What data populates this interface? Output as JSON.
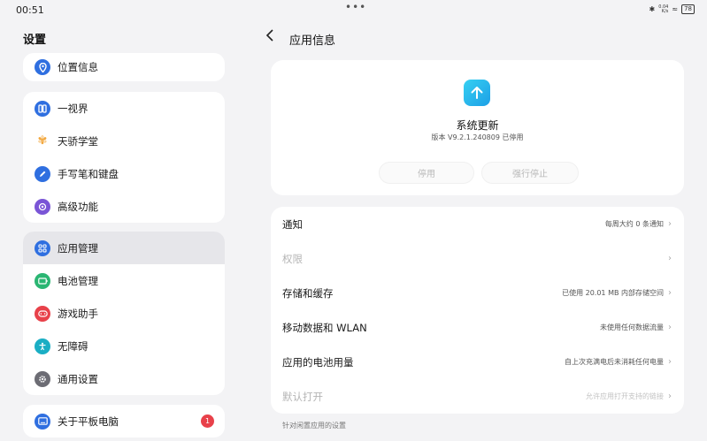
{
  "status_bar": {
    "time": "00:51",
    "dots": "•••",
    "network": "0.04\nK/s",
    "battery": "78"
  },
  "left": {
    "title": "设置",
    "groups": [
      {
        "items": [
          {
            "label": "位置信息",
            "icon": "location-icon",
            "color": "#2f6fe0"
          }
        ]
      },
      {
        "items": [
          {
            "label": "一视界",
            "icon": "split-screen-icon",
            "color": "#2f6fe0"
          },
          {
            "label": "天骄学堂",
            "icon": "butterfly-icon",
            "color": "#f2a63b"
          },
          {
            "label": "手写笔和键盘",
            "icon": "pen-icon",
            "color": "#2f6fe0"
          },
          {
            "label": "高级功能",
            "icon": "advanced-icon",
            "color": "#7a55d6"
          }
        ]
      },
      {
        "items": [
          {
            "label": "应用管理",
            "icon": "apps-icon",
            "color": "#2f6fe0"
          },
          {
            "label": "电池管理",
            "icon": "battery-icon",
            "color": "#2bb673"
          },
          {
            "label": "游戏助手",
            "icon": "gamepad-icon",
            "color": "#e8414a"
          },
          {
            "label": "无障碍",
            "icon": "accessibility-icon",
            "color": "#1aaec4"
          },
          {
            "label": "通用设置",
            "icon": "gear-icon",
            "color": "#6c6c74"
          }
        ]
      },
      {
        "items": [
          {
            "label": "关于平板电脑",
            "icon": "tablet-icon",
            "color": "#2f6fe0",
            "badge": "1"
          }
        ]
      }
    ]
  },
  "right": {
    "title": "应用信息",
    "app": {
      "name": "系统更新",
      "version": "版本 V9.2.1.240809 已停用",
      "disable_label": "停用",
      "force_stop_label": "强行停止"
    },
    "settings": [
      {
        "label": "通知",
        "value": "每周大约 0 条通知",
        "disabled": false
      },
      {
        "label": "权限",
        "value": "",
        "disabled": true
      },
      {
        "label": "存储和缓存",
        "value": "已使用 20.01 MB 内部存储空间",
        "disabled": false
      },
      {
        "label": "移动数据和 WLAN",
        "value": "未使用任何数据流量",
        "disabled": false
      },
      {
        "label": "应用的电池用量",
        "value": "自上次充满电后未消耗任何电量",
        "disabled": false
      },
      {
        "label": "默认打开",
        "value": "允许应用打开支持的链接",
        "disabled": true
      }
    ],
    "section_header": "针对闲置应用的设置"
  }
}
